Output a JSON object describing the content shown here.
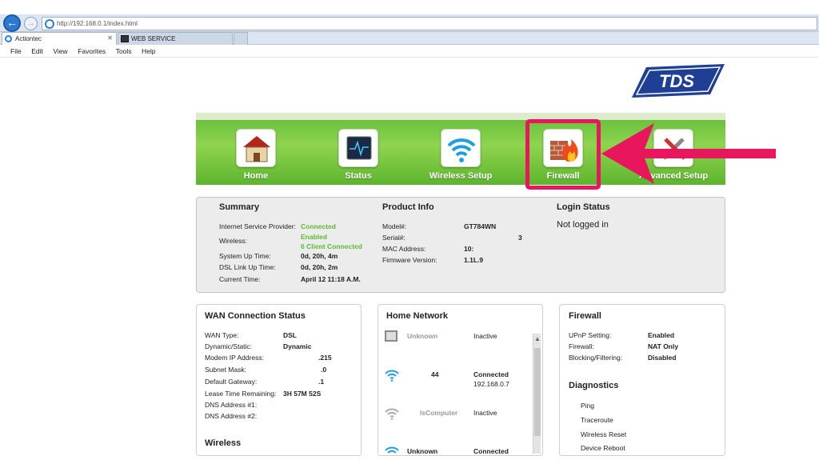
{
  "browser": {
    "url": "http://192.168.0.1/index.html",
    "tabs": [
      {
        "label": "Actiontec",
        "close": "✕"
      },
      {
        "label": "WEB SERVICE"
      }
    ],
    "menu": [
      "File",
      "Edit",
      "View",
      "Favorites",
      "Tools",
      "Help"
    ]
  },
  "logo": {
    "text": "TDS"
  },
  "nav": {
    "items": [
      {
        "label": "Home",
        "icon": "house-icon"
      },
      {
        "label": "Status",
        "icon": "monitor-icon"
      },
      {
        "label": "Wireless Setup",
        "icon": "wifi-icon"
      },
      {
        "label": "Firewall",
        "icon": "firewall-icon"
      },
      {
        "label": "Advanced Setup",
        "icon": "tools-icon"
      }
    ],
    "highlight_color": "#e8175d"
  },
  "summary": {
    "title": "Summary",
    "rows": [
      {
        "label": "Internet Service Provider:",
        "value": "Connected"
      },
      {
        "label": "Wireless:",
        "value": "Enabled",
        "value2": "6 Client Connected"
      },
      {
        "label": "System Up Time:",
        "value": "0d, 20h, 4m"
      },
      {
        "label": "DSL Link Up Time:",
        "value": "0d, 20h, 2m"
      },
      {
        "label": "Current Time:",
        "value": "April 12 11:18 A.M."
      }
    ]
  },
  "product": {
    "title": "Product Info",
    "rows": [
      {
        "label": "Model#:",
        "value": "GT784WN"
      },
      {
        "label": "Serial#:",
        "value": "3"
      },
      {
        "label": "MAC Address:",
        "value": "10:"
      },
      {
        "label": "Firmware Version:",
        "value": "1.1L.9"
      }
    ]
  },
  "login": {
    "title": "Login Status",
    "status": "Not logged in"
  },
  "wan": {
    "title": "WAN Connection Status",
    "rows": [
      {
        "label": "WAN Type:",
        "value": "DSL"
      },
      {
        "label": "Dynamic/Static:",
        "value": "Dynamic"
      },
      {
        "label": "Modem IP Address:",
        "value": ".215"
      },
      {
        "label": "Subnet Mask:",
        "value": ".0"
      },
      {
        "label": "Default Gateway:",
        "value": ".1"
      },
      {
        "label": "Lease Time Remaining:",
        "value": "3H 57M 52S"
      },
      {
        "label": "DNS Address #1:",
        "value": ""
      },
      {
        "label": "DNS Address #2:",
        "value": ""
      }
    ],
    "wireless_title": "Wireless"
  },
  "home_network": {
    "title": "Home Network",
    "devices": [
      {
        "name": "Unknown",
        "status": "Inactive",
        "ip": "",
        "icon": "computer-icon"
      },
      {
        "name": "44",
        "status": "Connected",
        "ip": "192.168.0.7",
        "icon": "wifi-icon"
      },
      {
        "name": "lsComputer",
        "status": "Inactive",
        "ip": "",
        "icon": "wifi-icon"
      },
      {
        "name": "Unknown",
        "status": "Connected",
        "ip": "",
        "icon": "wifi-icon"
      }
    ]
  },
  "firewall": {
    "title": "Firewall",
    "rows": [
      {
        "label": "UPnP Setting:",
        "value": "Enabled"
      },
      {
        "label": "Firewall:",
        "value": "NAT Only"
      },
      {
        "label": "Blocking/Filtering:",
        "value": "Disabled"
      }
    ],
    "diag_title": "Diagnostics",
    "diag_links": [
      "Ping",
      "Traceroute",
      "Wireless Reset",
      "Device Reboot"
    ]
  }
}
